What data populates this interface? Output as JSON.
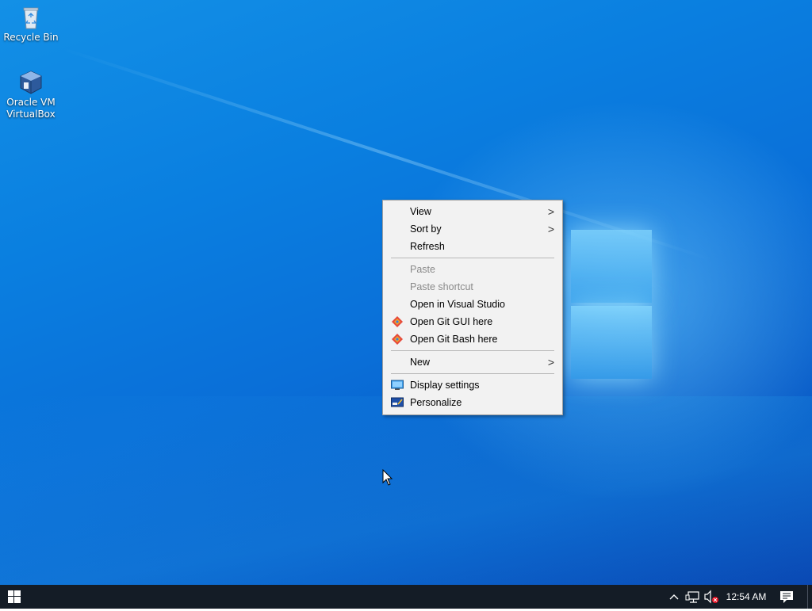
{
  "desktop": {
    "icons": [
      {
        "label": "Recycle Bin",
        "icon": "recycle-bin-icon"
      },
      {
        "label": "Oracle VM\nVirtualBox",
        "icon": "virtualbox-icon"
      }
    ]
  },
  "context_menu": {
    "items": [
      {
        "label": "View",
        "submenu": true
      },
      {
        "label": "Sort by",
        "submenu": true
      },
      {
        "label": "Refresh"
      },
      {
        "label": "Paste",
        "disabled": true
      },
      {
        "label": "Paste shortcut",
        "disabled": true
      },
      {
        "label": "Open in Visual Studio"
      },
      {
        "label": "Open Git GUI here",
        "icon": "git-icon"
      },
      {
        "label": "Open Git Bash here",
        "icon": "git-icon"
      },
      {
        "label": "New",
        "submenu": true
      },
      {
        "label": "Display settings",
        "icon": "display-icon"
      },
      {
        "label": "Personalize",
        "icon": "personalize-icon"
      }
    ],
    "submenu_arrow": ">"
  },
  "taskbar": {
    "clock": "12:54 AM",
    "tray_icons": [
      "chevron-up-icon",
      "network-icon",
      "volume-muted-icon"
    ],
    "start_icon": "windows-logo-icon",
    "notification_icon": "action-center-icon"
  },
  "colors": {
    "taskbar": "#141c26",
    "menu_bg": "#f2f2f2",
    "wallpaper_blue": "#0a7fe0"
  }
}
